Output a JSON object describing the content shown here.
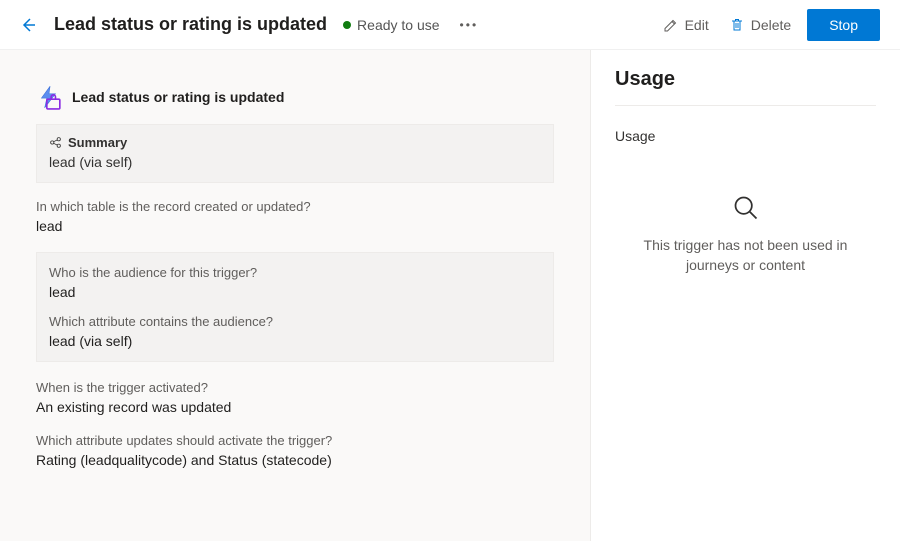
{
  "header": {
    "title": "Lead status or rating is updated",
    "status_label": "Ready to use",
    "status_color": "#107c10",
    "edit_label": "Edit",
    "delete_label": "Delete",
    "stop_label": "Stop"
  },
  "trigger": {
    "icon": "lightning",
    "name": "Lead status or rating is updated",
    "summary_label": "Summary",
    "summary_value": "lead (via self)",
    "questions": [
      {
        "label": "In which table is the record created or updated?",
        "value": "lead"
      }
    ],
    "boxed": [
      {
        "label": "Who is the audience for this trigger?",
        "value": "lead"
      },
      {
        "label": "Which attribute contains the audience?",
        "value": "lead (via self)"
      }
    ],
    "more": [
      {
        "label": "When is the trigger activated?",
        "value": "An existing record was updated"
      },
      {
        "label": "Which attribute updates should activate the trigger?",
        "value": "Rating (leadqualitycode) and Status (statecode)"
      }
    ]
  },
  "usage": {
    "title": "Usage",
    "subtitle": "Usage",
    "empty_message": "This trigger has not been used in journeys or content"
  }
}
